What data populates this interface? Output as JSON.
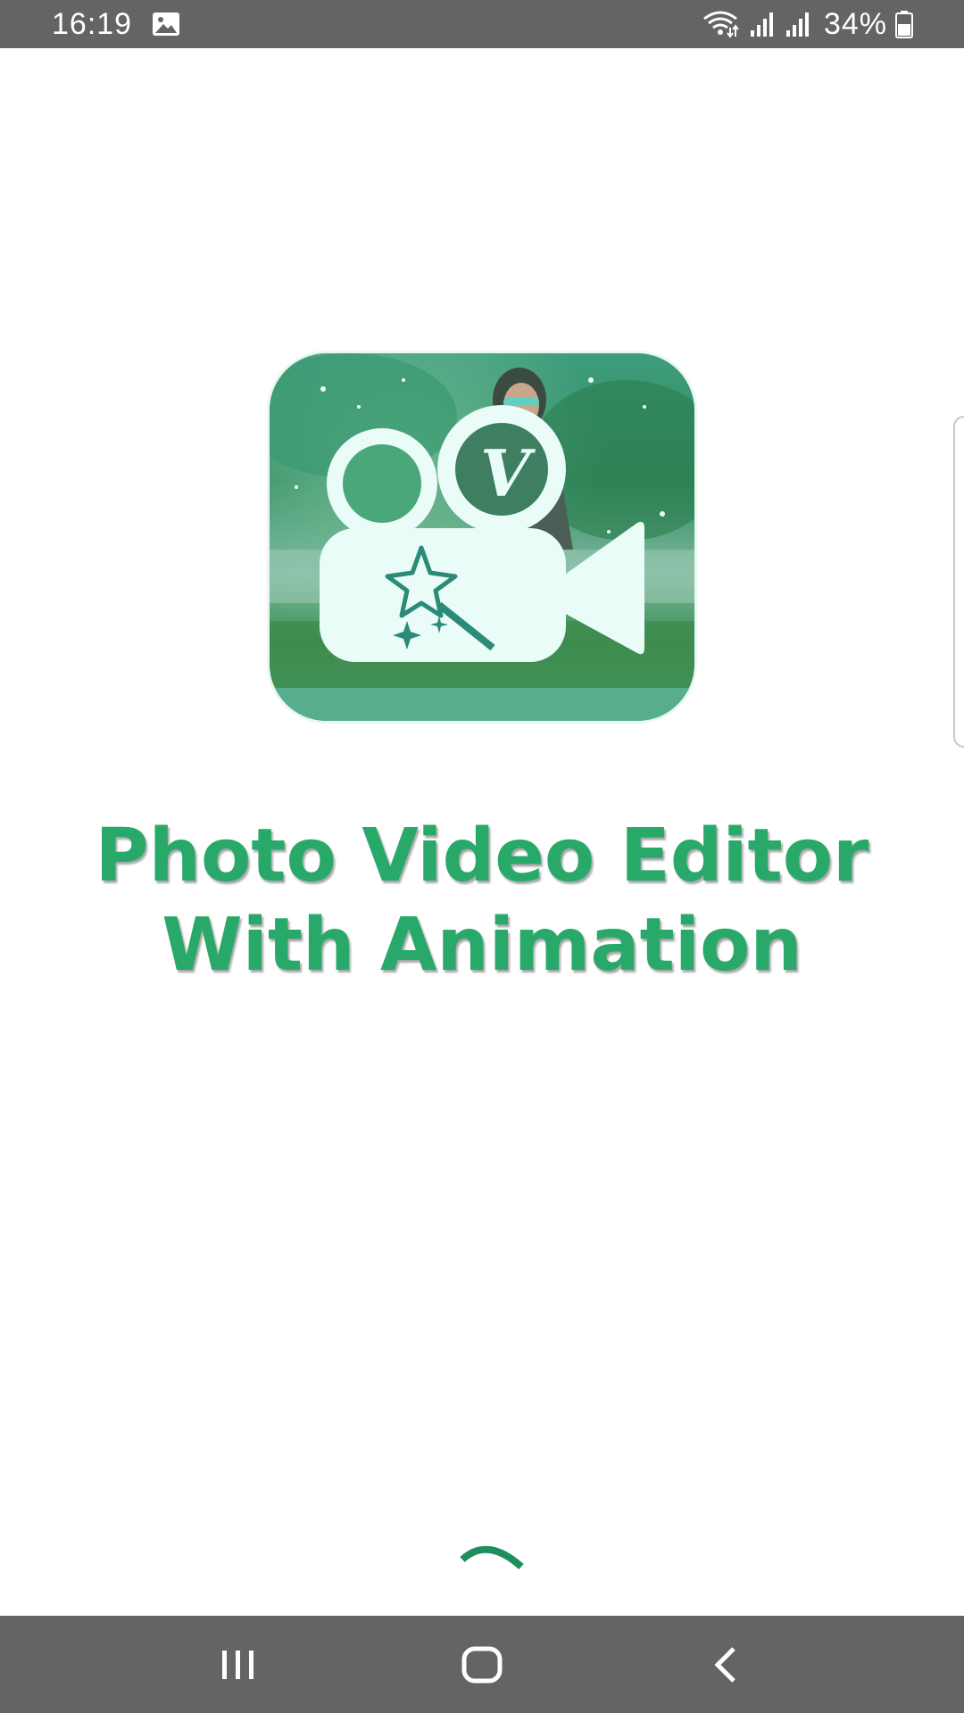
{
  "status_bar": {
    "time": "16:19",
    "battery": "34%",
    "icons": [
      "image-icon",
      "wifi-icon",
      "signal-icon",
      "signal-icon",
      "battery-icon"
    ]
  },
  "splash": {
    "title_line1": "Photo Video Editor",
    "title_line2": "With Animation",
    "logo_icon": "video-camera-magic-wand-icon",
    "logo_badge_letter": "V",
    "accent_color": "#28a96a"
  },
  "loading": {
    "indicator": "loading-spinner",
    "color": "#1e8f5c"
  },
  "nav_bar": {
    "buttons": [
      "recent-apps-icon",
      "home-icon",
      "back-icon"
    ]
  }
}
